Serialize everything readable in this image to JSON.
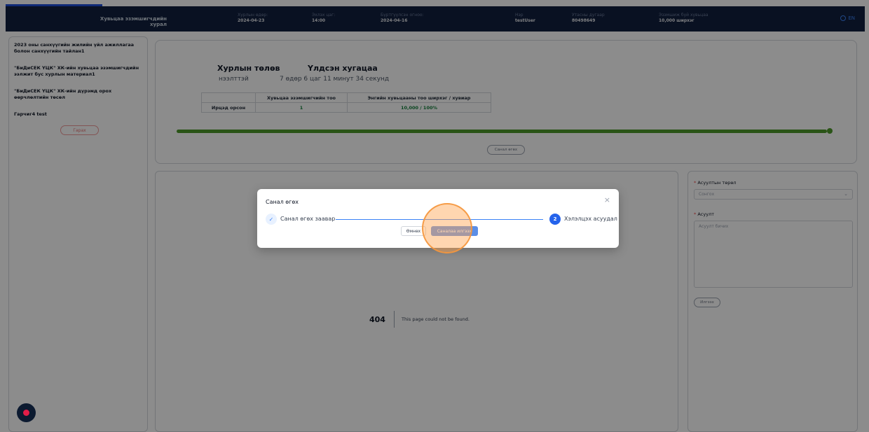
{
  "header": {
    "title": "Хувьцаа эзэмшигчдийн хурал",
    "items": [
      {
        "label": "Хурлын өдөр:",
        "value": "2024-04-23"
      },
      {
        "label": "Эхлэх цаг:",
        "value": "14:00"
      },
      {
        "label": "Бүртгүүлсэн огноо:",
        "value": "2024-04-16"
      },
      {
        "label": "Нэр",
        "value": "testUser"
      },
      {
        "label": "Утасны дугаар",
        "value": "80498649"
      },
      {
        "label": "Эзэмшиж буй хувьцаа",
        "value": "10,000 ширхэг"
      }
    ],
    "language": "EN"
  },
  "sidebar": {
    "items": [
      "2023 оны санхүүгийн жилийн үйл ажиллагаа болон санхүүгийн тайлан1",
      "\"БиДиСЕК ҮЦК\" ХК-ийн хувьцаа эзэмшигчдийн ээлжит бус хурлын материал1",
      "\"БиДиСЕК ҮЦК\" ХК-ийн дүрэмд орох өөрчлөлтийн төсөл",
      "Гарчиг4 test"
    ],
    "back_button": "Гарах"
  },
  "meeting": {
    "status_heading": "Хурлын төлөв",
    "status_value": "нээлттэй",
    "remaining_heading": "Үлдсэн хугацаа",
    "remaining_value": "7 өдөр 6 цаг 11 минут 34 секунд",
    "table": {
      "headers": [
        "",
        "Хувьцаа эзэмшигчийн тоо",
        "Энгийн хувьцааны тоо ширхэг / хувиар"
      ],
      "row": [
        "Ирцэд орсон",
        "1",
        "10,000 / 100%"
      ]
    },
    "progress": 1.0,
    "vote_button": "Санал өгөх"
  },
  "not_found": {
    "code": "404",
    "message": "This page could not be found."
  },
  "question_form": {
    "type_label": "Асуултын төрөл",
    "type_placeholder": "Сонгох",
    "question_label": "Асуулт",
    "question_placeholder": "Асуулт бичих",
    "send_button": "Илгээх"
  },
  "modal": {
    "title": "Санал өгөх",
    "close": "×",
    "step1_label": "Санал өгөх заавар",
    "step1_icon": "✓",
    "step2_number": "2",
    "step2_label": "Хэлэлцэх асуудал",
    "prev_button": "Өмнөх",
    "submit_button": "Саналаа илгээх"
  }
}
